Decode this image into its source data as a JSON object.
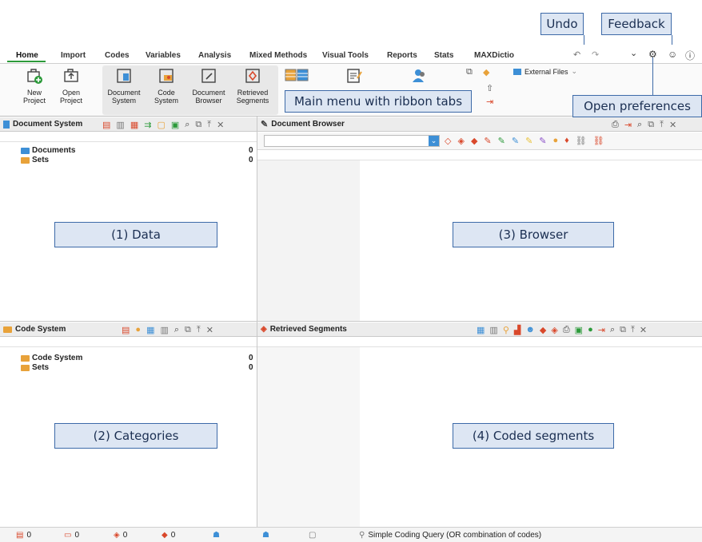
{
  "callouts": {
    "undo": "Undo",
    "feedback": "Feedback",
    "main_menu": "Main menu with ribbon tabs",
    "open_preferences": "Open preferences",
    "data": "(1) Data",
    "browser": "(3) Browser",
    "categories": "(2) Categories",
    "coded_segments": "(4) Coded segments"
  },
  "tabs": [
    "Home",
    "Import",
    "Codes",
    "Variables",
    "Analysis",
    "Mixed Methods",
    "Visual Tools",
    "Reports",
    "Stats",
    "MAXDictio"
  ],
  "ribbon": {
    "new_project": [
      "New",
      "Project"
    ],
    "open_project": [
      "Open",
      "Project"
    ],
    "document_system": [
      "Document",
      "System"
    ],
    "code_system": [
      "Code",
      "System"
    ],
    "document_browser": [
      "Document",
      "Browser"
    ],
    "retrieved_segments": [
      "Retrieved",
      "Segments"
    ],
    "external_files": "External Files"
  },
  "panes": {
    "document_system": {
      "title": "Document System",
      "rows": [
        {
          "label": "Documents",
          "count": "0"
        },
        {
          "label": "Sets",
          "count": "0"
        }
      ]
    },
    "document_browser": {
      "title": "Document Browser"
    },
    "code_system": {
      "title": "Code System",
      "rows": [
        {
          "label": "Code System",
          "count": "0"
        },
        {
          "label": "Sets",
          "count": "0"
        }
      ]
    },
    "retrieved_segments": {
      "title": "Retrieved Segments"
    }
  },
  "status_bar": {
    "docs": "0",
    "codes": "0",
    "segments": "0",
    "memos": "0",
    "query": "Simple Coding Query (OR combination of codes)"
  },
  "colors": {
    "accent_green": "#2c9a3a",
    "callout_fill": "#dde6f3",
    "callout_border": "#3d6aa8",
    "folder_blue": "#3d8fd6",
    "folder_orange": "#e8a23a",
    "code_red": "#d9482b"
  }
}
